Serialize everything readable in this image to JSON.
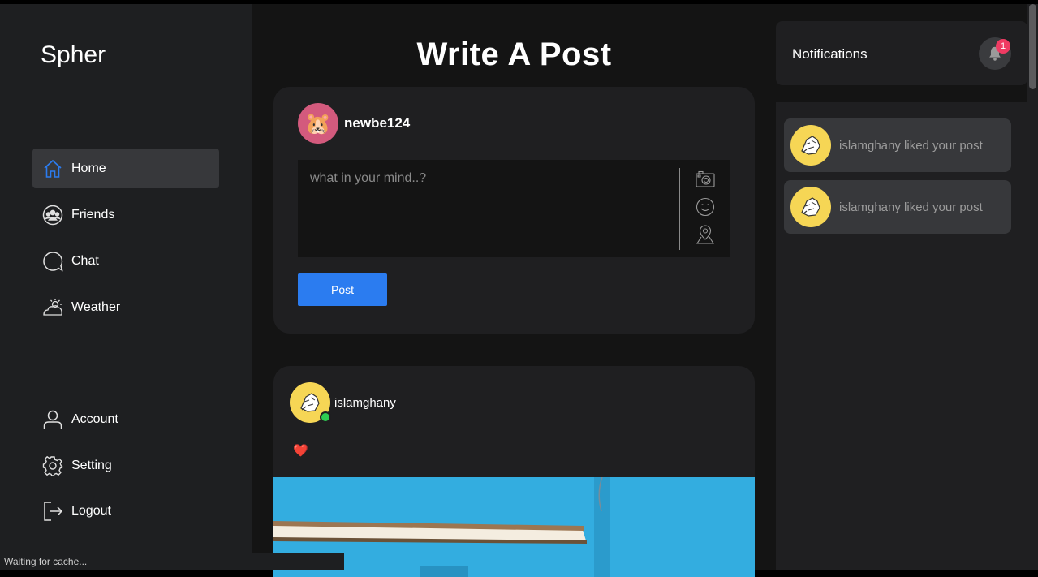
{
  "sidebar": {
    "brand": "Spher",
    "items": [
      {
        "label": "Home",
        "icon": "home-icon",
        "active": true
      },
      {
        "label": "Friends",
        "icon": "friends-icon"
      },
      {
        "label": "Chat",
        "icon": "chat-icon"
      },
      {
        "label": "Weather",
        "icon": "weather-icon"
      }
    ],
    "bottom_items": [
      {
        "label": "Account",
        "icon": "account-icon"
      },
      {
        "label": "Setting",
        "icon": "gear-icon"
      },
      {
        "label": "Logout",
        "icon": "logout-icon"
      }
    ]
  },
  "main": {
    "title": "Write A Post",
    "composer": {
      "username": "newbe124",
      "avatar_icon": "hamster-avatar",
      "placeholder": "what in your mind..?",
      "tools": [
        "camera-icon",
        "emoji-icon",
        "location-icon"
      ],
      "post_label": "Post"
    },
    "post": {
      "author": "islamghany",
      "avatar_icon": "cartoon-avatar",
      "online": true,
      "text": "❤️"
    }
  },
  "notifications": {
    "title": "Notifications",
    "badge_count": "1",
    "items": [
      {
        "text": "islamghany liked your post"
      },
      {
        "text": "islamghany liked your post"
      }
    ]
  },
  "status_bar": "Waiting for cache...",
  "colors": {
    "accent": "#2b7cf0",
    "badge": "#ef3b63",
    "online": "#2ecc52",
    "avatar_yellow": "#f6d655",
    "avatar_pink": "#d35a7d"
  }
}
